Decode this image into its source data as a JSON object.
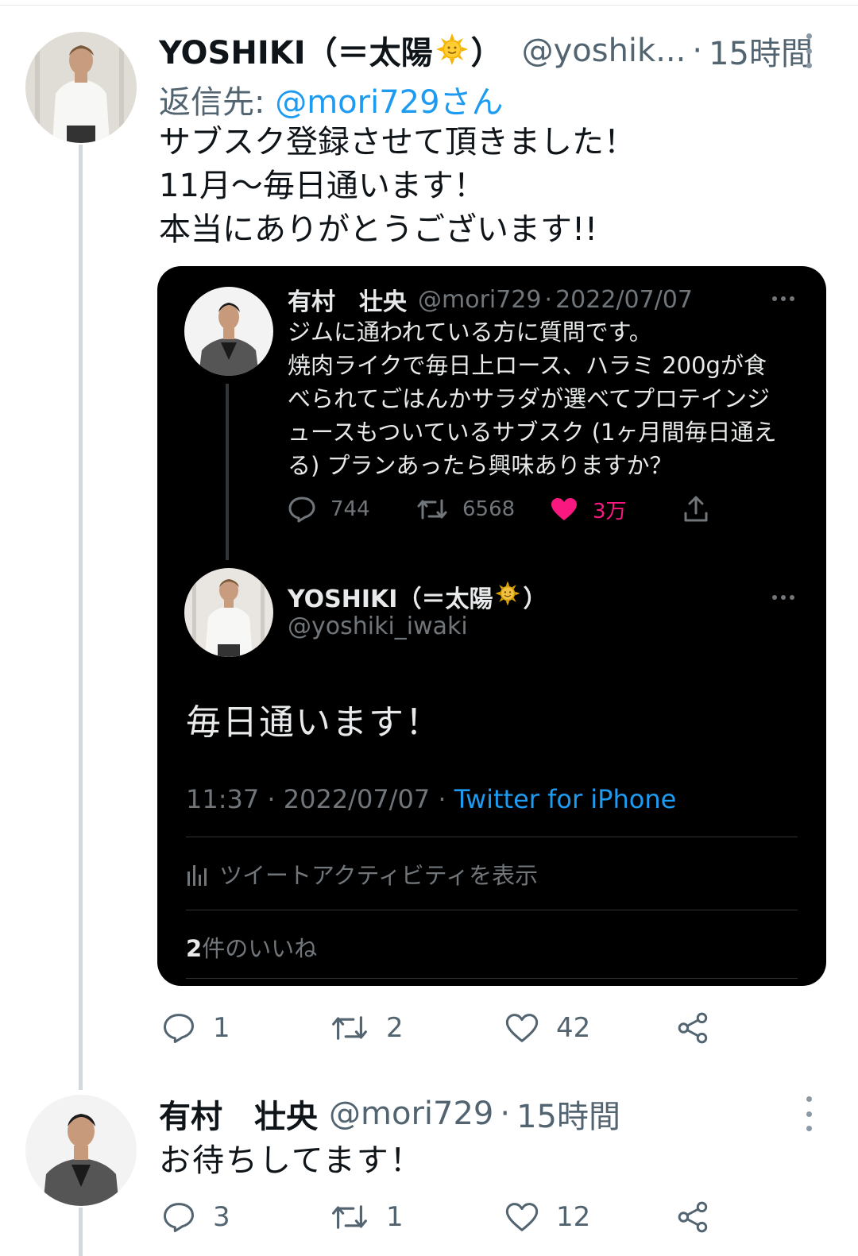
{
  "tweet1": {
    "display_name": "YOSHIKI（＝太陽",
    "display_name_close": "）",
    "handle": "@yoshik...",
    "separator": "·",
    "time": "15時間",
    "reply_prefix": "返信先: ",
    "reply_mention": "@mori729さん",
    "body_lines": [
      "サブスク登録させて頂きました！",
      "11月〜毎日通います！",
      "本当にありがとうございます!!"
    ],
    "actions": {
      "reply_count": "1",
      "retweet_count": "2",
      "like_count": "42"
    }
  },
  "quote_card": {
    "original": {
      "name": "有村　壮央",
      "handle": "@mori729",
      "separator": "·",
      "date": "2022/07/07",
      "body_lines": [
        "ジムに通われている方に質問です。",
        "焼肉ライクで毎日上ロース、ハラミ 200gが食",
        "べられてごはんかサラダが選べてプロテインジ",
        "ュースもついているサブスク (1ヶ月間毎日通え",
        "る) プランあったら興味ありますか？"
      ],
      "reply_count": "744",
      "retweet_count": "6568",
      "like_count": "3万"
    },
    "reply": {
      "name": "YOSHIKI（＝太陽",
      "name_close": "）",
      "handle": "@yoshiki_iwaki",
      "body": "毎日通います！",
      "time": "11:37",
      "sep": " · ",
      "date": "2022/07/07",
      "client": "Twitter for iPhone",
      "activity": "ツイートアクティビティを表示",
      "likes_count": "2",
      "likes_label": "件のいいね"
    }
  },
  "tweet2": {
    "display_name": "有村　壮央",
    "handle": "@mori729",
    "separator": "·",
    "time": "15時間",
    "body": "お待ちしてます！",
    "actions": {
      "reply_count": "3",
      "retweet_count": "1",
      "like_count": "12"
    }
  },
  "colors": {
    "accent": "#1d9bf0",
    "like_pink": "#f91880",
    "muted": "#536471",
    "card_bg": "#000000"
  }
}
